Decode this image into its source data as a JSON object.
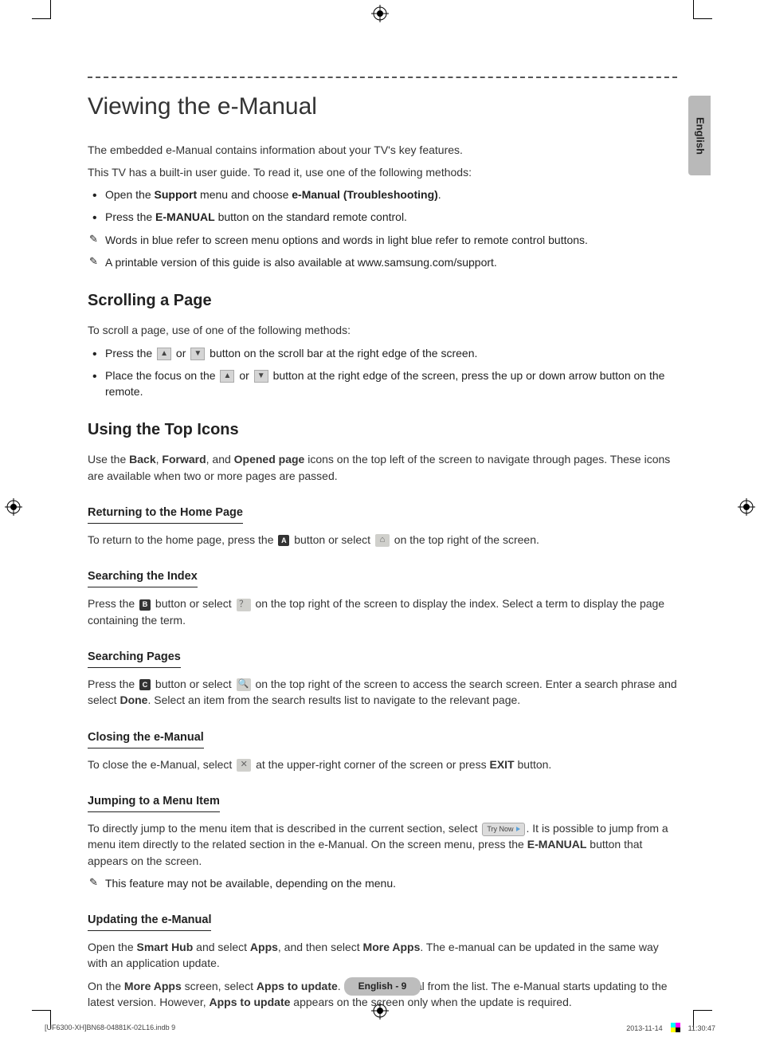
{
  "language_tab": "English",
  "title": "Viewing the e-Manual",
  "intro": [
    "The embedded e-Manual contains information about your TV's key features.",
    "This TV has a built-in user guide. To read it, use one of the following methods:"
  ],
  "intro_bullets": [
    {
      "pre": "Open the ",
      "b1": "Support",
      "mid": " menu and choose ",
      "b2": "e-Manual (Troubleshooting)",
      "post": "."
    },
    {
      "pre": "Press the ",
      "b1": "E-MANUAL",
      "mid": " button on the standard remote control.",
      "b2": "",
      "post": ""
    }
  ],
  "intro_notes": [
    "Words in blue refer to screen menu options and words in light blue refer to remote control buttons.",
    "A printable version of this guide is also available at www.samsung.com/support."
  ],
  "scrolling": {
    "heading": "Scrolling a Page",
    "lead": "To scroll a page, use of one of the following methods:",
    "b1_pre": "Press the ",
    "b1_mid": " or ",
    "b1_post": " button on the scroll bar at the right edge of the screen.",
    "b2_pre": "Place the focus on the ",
    "b2_mid": " or ",
    "b2_post": " button at the right edge of the screen, press the up or down arrow button on the remote."
  },
  "topicons": {
    "heading": "Using the Top Icons",
    "lead_pre": "Use the ",
    "b_back": "Back",
    "sep1": ", ",
    "b_fwd": "Forward",
    "sep2": ", and ",
    "b_opened": "Opened page",
    "lead_post": " icons on the top left of the screen to navigate through pages. These icons are available when two or more pages are passed."
  },
  "return_home": {
    "heading": "Returning to the Home Page",
    "pre": "To return to the home page, press the ",
    "key": "A",
    "mid": " button or select ",
    "post": " on the top right of the screen."
  },
  "search_index": {
    "heading": "Searching the Index",
    "pre": "Press the ",
    "key": "B",
    "mid": " button or select ",
    "post": " on the top right of the screen to display the index. Select a term to display the page containing the term."
  },
  "search_pages": {
    "heading": "Searching Pages",
    "pre": "Press the ",
    "key": "C",
    "mid": " button or select ",
    "post": " on the top right of the screen to access the search screen. Enter a search phrase and select ",
    "b_done": "Done",
    "tail": ". Select an item from the search results list to navigate to the relevant page."
  },
  "closing": {
    "heading": "Closing the e-Manual",
    "pre": "To close the e-Manual, select ",
    "mid": " at the upper-right corner of the screen or press ",
    "b_exit": "EXIT",
    "post": " button."
  },
  "jumping": {
    "heading": "Jumping to a Menu Item",
    "pre": "To directly jump to the menu item that is described in the current section, select ",
    "try_label": "Try Now",
    "mid": ". It is possible to jump from a menu item directly to the related section in the e-Manual. On the screen menu, press the ",
    "b_eman": "E-MANUAL",
    "post": " button that appears on the screen.",
    "note": "This feature may not be available, depending on the menu."
  },
  "updating": {
    "heading": "Updating the e-Manual",
    "p1_pre": "Open the ",
    "b_sh": "Smart Hub",
    "p1_mid1": " and select ",
    "b_apps": "Apps",
    "p1_mid2": ", and then select ",
    "b_more": "More Apps",
    "p1_post": ". The e-manual can be updated in the same way with an application update.",
    "p2_pre": "On the ",
    "b_more2": "More Apps",
    "p2_mid1": " screen, select ",
    "b_upd": "Apps to update",
    "p2_mid2": ". Select e-Manual from the list. The e-Manual starts updating to the latest version. However, ",
    "b_upd2": "Apps to update",
    "p2_post": " appears on the screen only when the update is required."
  },
  "footer": {
    "page_label": "English - 9",
    "file": "[UF6300-XH]BN68-04881K-02L16.indb   9",
    "date": "2013-11-14",
    "time": "11:30:47"
  },
  "icons": {
    "up": "▲",
    "down": "▼",
    "home": "⌂",
    "book": "？",
    "search": "🔍",
    "close": "✕"
  }
}
